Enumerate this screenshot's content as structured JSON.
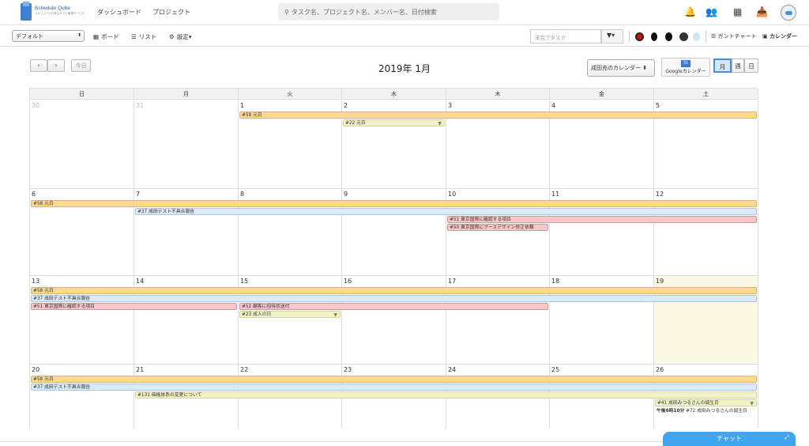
{
  "header": {
    "logo_name": "Schedule Qube",
    "logo_tagline": "スケジュール共有＆タスク管理サービス",
    "nav": [
      "ダッシュボード",
      "プロジェクト"
    ],
    "search_placeholder": "タスク名、プロジェクト名、メンバー名、日付検索"
  },
  "toolbar": {
    "preset": "デフォルト",
    "board": "ボード",
    "list": "リスト",
    "settings": "設定",
    "incomplete_placeholder": "未完了タスク",
    "gantt": "ガントチャート",
    "calendar": "カレンダー"
  },
  "calendar": {
    "today_label": "今日",
    "title": "2019年 1月",
    "calendar_select": "成田充のカレンダー",
    "google_label": "Googleカレンダー",
    "google_day": "31",
    "views": [
      "月",
      "週",
      "日"
    ],
    "weekdays": [
      "日",
      "月",
      "火",
      "水",
      "木",
      "金",
      "土"
    ],
    "weeks": [
      [
        "30",
        "31",
        "1",
        "2",
        "3",
        "4",
        "5"
      ],
      [
        "6",
        "7",
        "8",
        "9",
        "10",
        "11",
        "12"
      ],
      [
        "13",
        "14",
        "15",
        "16",
        "17",
        "18",
        "19"
      ],
      [
        "20",
        "21",
        "22",
        "23",
        "24",
        "25",
        "26"
      ]
    ],
    "events": {
      "e1": "#58 元日",
      "e2": "#22 元日",
      "e3": "#58 元日",
      "e4": "#37 成田テスト不具合報告",
      "e5": "#51 東京国際に確認する項目",
      "e6": "#50 東京国際にブースデザイン修正依頼",
      "e7": "#58 元日",
      "e8": "#37 成田テスト不具合報告",
      "e9": "#51 東京国際に確認する項目",
      "e10": "#52 顧客に招待状送付",
      "e11": "#23 成人の日",
      "e12": "#58 元日",
      "e13": "#37 成田テスト不具合報告",
      "e14": "#131 価格体系の変更について",
      "e15": "#41 成田みつるさんの誕生日",
      "e16_time": "午後6時10分",
      "e16": "#72 成田みつるさんの誕生日"
    }
  },
  "chat": {
    "label": "チャット"
  },
  "colors": {
    "accent": "#4a8fd1",
    "chat": "#3fa5ef",
    "event_orange": "#fdd98a",
    "event_blue": "#dbe9f8",
    "event_red": "#f7c7c9",
    "event_yellow": "#f2f3c4",
    "today_bg": "#fcf8e3"
  },
  "icons": [
    "search-icon",
    "bell-icon",
    "users-icon",
    "grid-icon",
    "inbox-icon",
    "filter-icon",
    "gear-icon",
    "list-icon",
    "board-icon",
    "calendar-icon",
    "gantt-icon",
    "expand-icon"
  ]
}
